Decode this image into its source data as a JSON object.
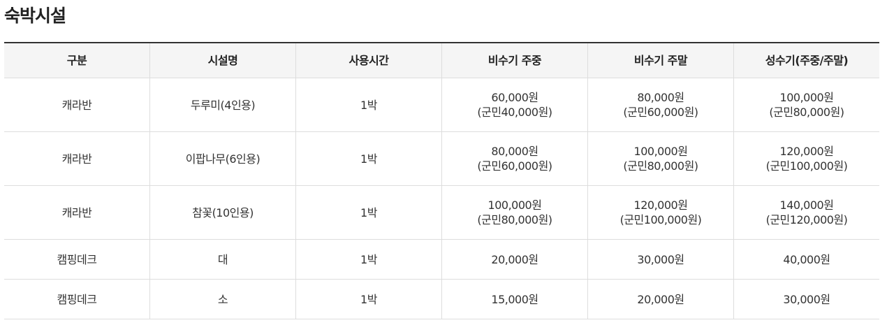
{
  "section": {
    "title": "숙박시설"
  },
  "table": {
    "headers": [
      "구분",
      "시설명",
      "사용시간",
      "비수기 주중",
      "비수기 주말",
      "성수기(주중/주말)"
    ],
    "rows": [
      {
        "category": "캐라반",
        "facility": "두루미(4인용)",
        "duration": "1박",
        "offseason_weekday": {
          "price": "60,000원",
          "resident": "(군민40,000원)"
        },
        "offseason_weekend": {
          "price": "80,000원",
          "resident": "(군민60,000원)"
        },
        "peakseason": {
          "price": "100,000원",
          "resident": "(군민80,000원)"
        }
      },
      {
        "category": "캐라반",
        "facility": "이팝나무(6인용)",
        "duration": "1박",
        "offseason_weekday": {
          "price": "80,000원",
          "resident": "(군민60,000원)"
        },
        "offseason_weekend": {
          "price": "100,000원",
          "resident": "(군민80,000원)"
        },
        "peakseason": {
          "price": "120,000원",
          "resident": "(군민100,000원)"
        }
      },
      {
        "category": "캐라반",
        "facility": "참꽃(10인용)",
        "duration": "1박",
        "offseason_weekday": {
          "price": "100,000원",
          "resident": "(군민80,000원)"
        },
        "offseason_weekend": {
          "price": "120,000원",
          "resident": "(군민100,000원)"
        },
        "peakseason": {
          "price": "140,000원",
          "resident": "(군민120,000원)"
        }
      },
      {
        "category": "캠핑데크",
        "facility": "대",
        "duration": "1박",
        "offseason_weekday": {
          "price": "20,000원"
        },
        "offseason_weekend": {
          "price": "30,000원"
        },
        "peakseason": {
          "price": "40,000원"
        }
      },
      {
        "category": "캠핑데크",
        "facility": "소",
        "duration": "1박",
        "offseason_weekday": {
          "price": "15,000원"
        },
        "offseason_weekend": {
          "price": "20,000원"
        },
        "peakseason": {
          "price": "30,000원"
        }
      }
    ]
  }
}
